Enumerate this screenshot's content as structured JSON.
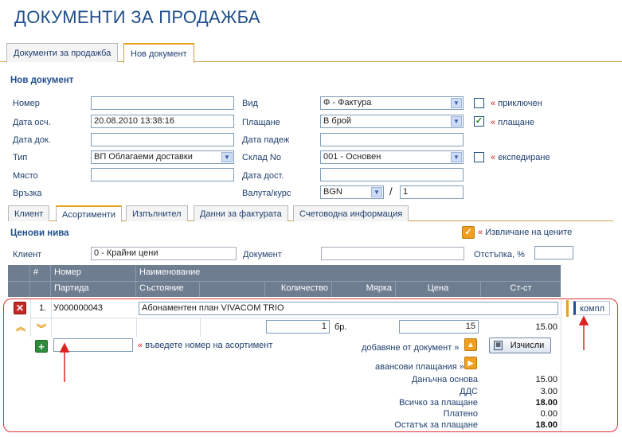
{
  "page": {
    "title": "ДОКУМЕНТИ ЗА ПРОДАЖБА"
  },
  "top_tabs": [
    {
      "label": "Документи за продажба"
    },
    {
      "label": "Нов документ"
    }
  ],
  "form": {
    "section_title": "Нов документ",
    "number": {
      "label": "Номер",
      "value": ""
    },
    "date_acc": {
      "label": "Дата осч.",
      "value": "20.08.2010 13:38:16"
    },
    "date_doc": {
      "label": "Дата док.",
      "value": ""
    },
    "type": {
      "label": "Тип",
      "value": "ВП Облагаеми доставки"
    },
    "place": {
      "label": "Място",
      "value": ""
    },
    "link": {
      "label": "Връзка"
    },
    "kind": {
      "label": "Вид",
      "value": "Ф - Фактура"
    },
    "payment": {
      "label": "Плащане",
      "value": "В брой"
    },
    "due_date": {
      "label": "Дата падеж",
      "value": ""
    },
    "warehouse": {
      "label": "Склад No",
      "value": "001 - Основен"
    },
    "delivery_date": {
      "label": "Дата дост.",
      "value": ""
    },
    "currency": {
      "label": "Валута/курс",
      "value": "BGN",
      "rate": "1",
      "separator": "/"
    },
    "closed": {
      "label": "приключен",
      "checked": false
    },
    "paid": {
      "label": "плащане",
      "checked": true
    },
    "shipping": {
      "label": "експедиране",
      "checked": false
    },
    "guillemet": "«"
  },
  "sub_tabs": [
    {
      "label": "Клиент"
    },
    {
      "label": "Асортименти"
    },
    {
      "label": "Изпълнител"
    },
    {
      "label": "Данни за фактурата"
    },
    {
      "label": "Счетоводна информация"
    }
  ],
  "assortment": {
    "price_levels_title": "Ценови нива",
    "extract_prices_label": "Извличане на цените",
    "client_label": "Клиент",
    "client_value": "0 - Крайни цени",
    "document_label": "Документ",
    "document_value": "",
    "discount_label": "Отстъпка, %",
    "discount_value": ""
  },
  "grid": {
    "header_row1": {
      "hash": "#",
      "number": "Номер",
      "name": "Наименование"
    },
    "header_row2": {
      "batch": "Партида",
      "state": "Състояние",
      "qty": "Количество",
      "unit": "Мярка",
      "price": "Цена",
      "value": "Ст-ст"
    },
    "row": {
      "index": "1.",
      "number": "У000000043",
      "name": "Абонаментен план VIVACOM TRIO",
      "quantity": "1",
      "unit": "бр.",
      "price": "15",
      "value": "15.00",
      "kit_label": "компл"
    },
    "new_item_placeholder": "",
    "enter_number_hint": "въведете номер на асортимент",
    "add_from_document": "добавяне от документ »",
    "calculate_button": "Изчисли",
    "advance_payments": "авансови плащания »"
  },
  "summary": [
    {
      "label": "Данъчна основа",
      "value": "15.00",
      "bold": false
    },
    {
      "label": "ДДС",
      "value": "3.00",
      "bold": false
    },
    {
      "label": "Всичко за плащане",
      "value": "18.00",
      "bold": true
    },
    {
      "label": "Платено",
      "value": "0.00",
      "bold": false
    },
    {
      "label": "Остатък за плащане",
      "value": "18.00",
      "bold": true
    }
  ],
  "colors": {
    "accent_orange": "#e8a020",
    "annotation_red": "#dd2222",
    "header_grey": "#6e7d90",
    "title_blue": "#1f4e8c"
  }
}
